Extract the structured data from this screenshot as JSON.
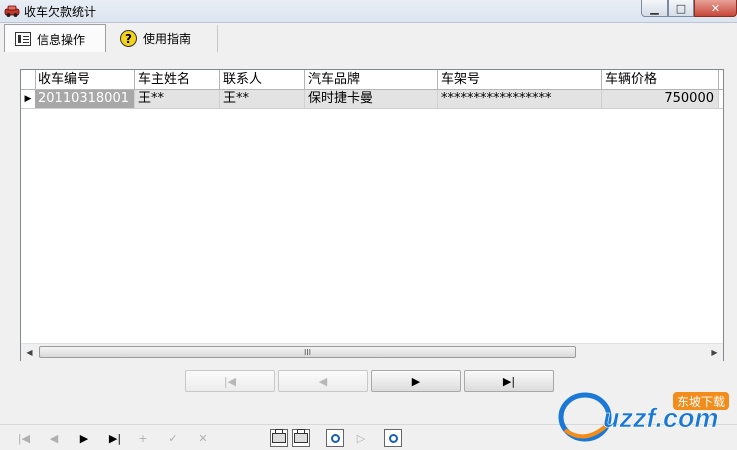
{
  "window": {
    "title": "收车欠款统计",
    "min_glyph": "▁",
    "max_glyph": "□",
    "close_glyph": "✕"
  },
  "tabs": [
    {
      "label": "信息操作",
      "icon": "list-icon"
    },
    {
      "label": "使用指南",
      "icon": "help-icon",
      "icon_glyph": "?"
    }
  ],
  "grid": {
    "columns": [
      "收车编号",
      "车主姓名",
      "联系人",
      "汽车品牌",
      "车架号",
      "车辆价格"
    ],
    "rows": [
      {
        "indicator": "▶",
        "cells": [
          "20110318001",
          "王**",
          "王**",
          "保时捷卡曼",
          "*****************",
          "750000"
        ]
      }
    ],
    "scroll_left": "◀",
    "scroll_right": "▶",
    "scroll_grip": "III"
  },
  "nav_buttons": {
    "first": "|◀",
    "prev": "◀",
    "next": "▶",
    "last": "▶|"
  },
  "toolbar": {
    "first": "|◀",
    "prev": "◀",
    "next": "▶",
    "last": "▶|",
    "add": "+",
    "edit": "✓",
    "cancel": "✕",
    "next_page": "▷"
  },
  "watermark": {
    "text": "uzzf.com",
    "badge": "东坡下载"
  },
  "colors": {
    "selected_row": "#a8a8a8",
    "logo_blue": "#1a78d6",
    "logo_orange": "#f28c1a"
  }
}
